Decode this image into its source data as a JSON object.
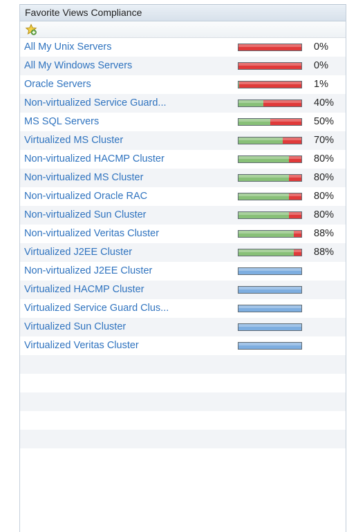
{
  "panel": {
    "title": "Favorite Views Compliance"
  },
  "toolbar": {
    "add_icon": "star-add-icon"
  },
  "colors": {
    "non_compliant": "#e03a3a",
    "compliant": "#88c078",
    "no_data": "#7eaee0",
    "link": "#2f73bf"
  },
  "views": [
    {
      "name": "All My Unix Servers",
      "percent_label": "0%",
      "compliance": 0
    },
    {
      "name": "All My Windows Servers",
      "percent_label": "0%",
      "compliance": 0
    },
    {
      "name": "Oracle Servers",
      "percent_label": "1%",
      "compliance": 1
    },
    {
      "name": "Non-virtualized Service Guard...",
      "percent_label": "40%",
      "compliance": 40
    },
    {
      "name": "MS SQL Servers",
      "percent_label": "50%",
      "compliance": 50
    },
    {
      "name": "Virtualized MS Cluster",
      "percent_label": "70%",
      "compliance": 70
    },
    {
      "name": "Non-virtualized HACMP Cluster",
      "percent_label": "80%",
      "compliance": 80
    },
    {
      "name": "Non-virtualized MS Cluster",
      "percent_label": "80%",
      "compliance": 80
    },
    {
      "name": "Non-virtualized Oracle RAC",
      "percent_label": "80%",
      "compliance": 80
    },
    {
      "name": "Non-virtualized Sun Cluster",
      "percent_label": "80%",
      "compliance": 80
    },
    {
      "name": "Non-virtualized Veritas Cluster",
      "percent_label": "88%",
      "compliance": 88
    },
    {
      "name": "Virtualized J2EE Cluster",
      "percent_label": "88%",
      "compliance": 88
    },
    {
      "name": "Non-virtualized J2EE Cluster",
      "percent_label": "",
      "compliance": null
    },
    {
      "name": "Virtualized HACMP Cluster",
      "percent_label": "",
      "compliance": null
    },
    {
      "name": "Virtualized Service Guard Clus...",
      "percent_label": "",
      "compliance": null
    },
    {
      "name": "Virtualized Sun Cluster",
      "percent_label": "",
      "compliance": null
    },
    {
      "name": "Virtualized Veritas Cluster",
      "percent_label": "",
      "compliance": null
    }
  ]
}
